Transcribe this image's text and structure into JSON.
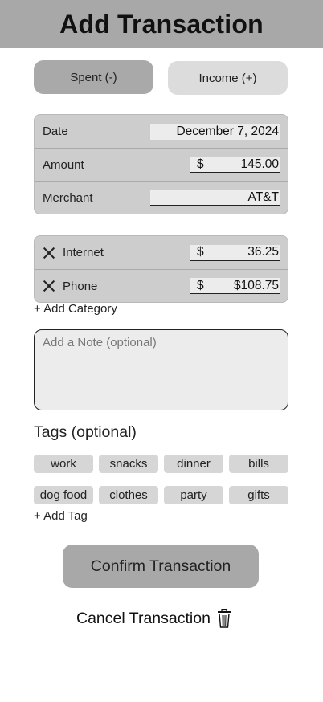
{
  "header": {
    "title": "Add Transaction"
  },
  "type_toggle": {
    "spent_label": "Spent (-)",
    "income_label": "Income (+)"
  },
  "details": {
    "date": {
      "label": "Date",
      "value": "December 7, 2024"
    },
    "amount": {
      "label": "Amount",
      "currency": "$",
      "value": "145.00"
    },
    "merchant": {
      "label": "Merchant",
      "value": "AT&T"
    }
  },
  "categories": {
    "items": [
      {
        "name": "Internet",
        "currency": "$",
        "amount": "36.25",
        "remove_icon": "close-icon"
      },
      {
        "name": "Phone",
        "currency": "$",
        "amount": "$108.75",
        "remove_icon": "close-icon"
      }
    ],
    "add_label": "+ Add Category"
  },
  "note": {
    "placeholder": "Add a Note (optional)",
    "value": ""
  },
  "tags": {
    "title": "Tags (optional)",
    "items": [
      "work",
      "snacks",
      "dinner",
      "bills",
      "dog food",
      "clothes",
      "party",
      "gifts"
    ],
    "add_label": "+ Add Tag"
  },
  "actions": {
    "confirm_label": "Confirm Transaction",
    "cancel_label": "Cancel Transaction",
    "cancel_icon": "trash-icon"
  },
  "colors": {
    "header_bg": "#a8a8a8",
    "selected_toggle": "#a9a9a9",
    "unselected_toggle": "#dcdcdc",
    "card_bg": "#cdcdcd",
    "field_bg": "#ececec",
    "tag_bg": "#d6d6d6"
  }
}
